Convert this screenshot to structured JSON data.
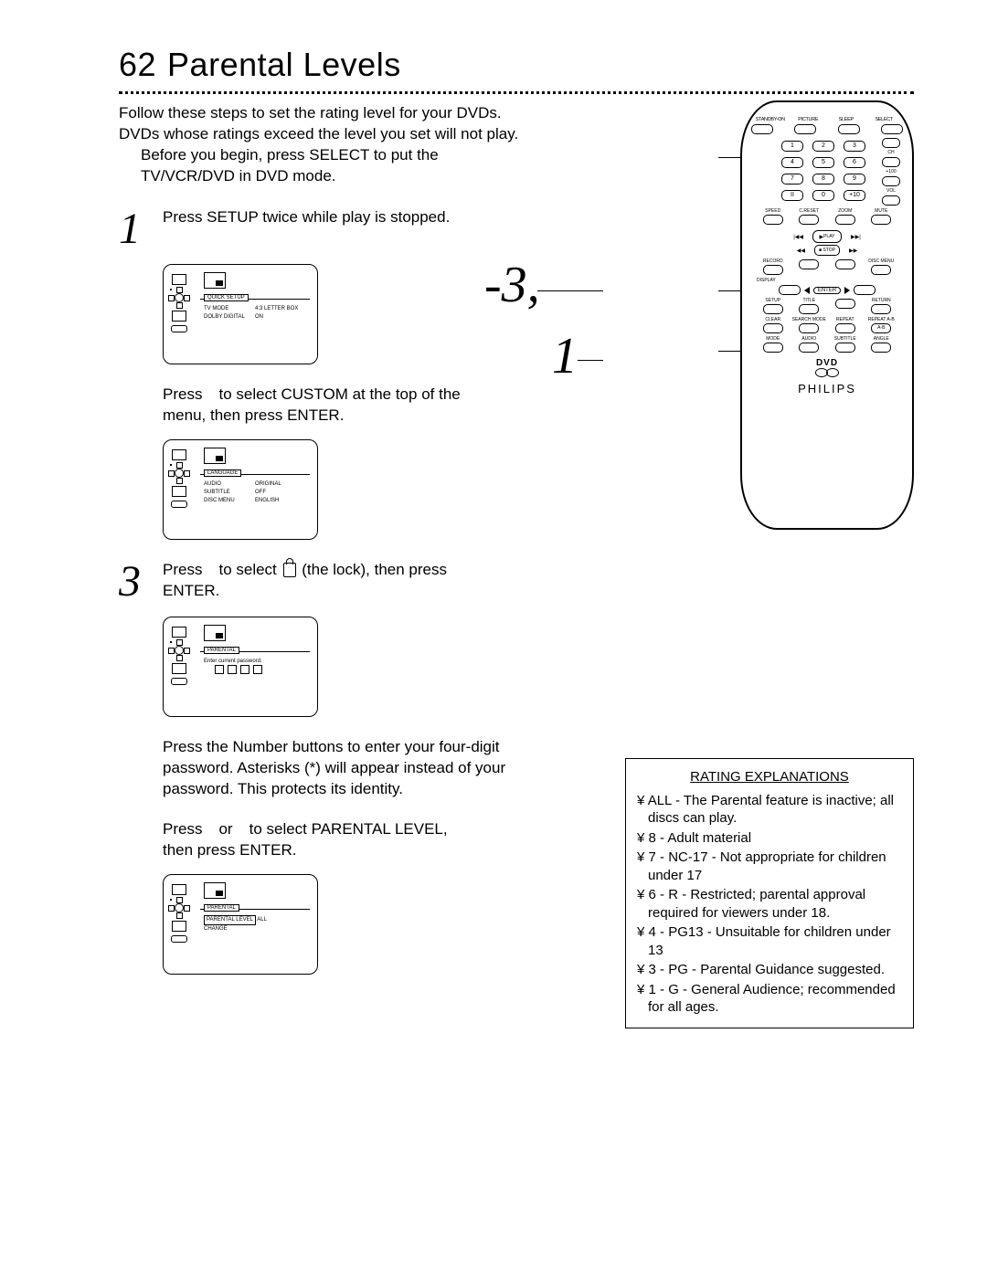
{
  "page": {
    "number": "62",
    "title": "Parental Levels"
  },
  "intro": {
    "line1": "Follow these steps to set the rating level for your DVDs.",
    "line2": "DVDs whose ratings exceed the level you set will not play.",
    "before1": "Before you begin, press SELECT to put the",
    "before2": "TV/VCR/DVD in DVD mode."
  },
  "steps": {
    "s1_num": "1",
    "s1_text": "Press SETUP twice while play is stopped.",
    "s2_text_a": "Press",
    "s2_text_b": "to select CUSTOM at the top of the",
    "s2_text_c": "menu, then press ENTER.",
    "s3_num": "3",
    "s3_text_a": "Press",
    "s3_text_b": "to select",
    "s3_text_c": "(the lock), then press",
    "s3_text_d": "ENTER.",
    "s4_text": "Press the Number buttons to enter your four-digit password. Asterisks (*) will appear instead of your password. This protects its identity.",
    "s5_text_a": "Press",
    "s5_text_b": "or",
    "s5_text_c": "to select PARENTAL LEVEL,",
    "s5_text_d": "then press ENTER."
  },
  "osd": {
    "tab_quick": "QUICK SETUP",
    "kv1a": "TV MODE",
    "kv1b": "4:3 LETTER BOX",
    "kv2a": "DOLBY DIGITAL",
    "kv2b": "ON",
    "tab_lang": "LANGUAGE",
    "kv3a": "AUDIO",
    "kv3b": "ORIGINAL",
    "kv4a": "SUBTITLE",
    "kv4b": "OFF",
    "kv5a": "DISC MENU",
    "kv5b": "ENGLISH",
    "tab_par": "PARENTAL",
    "par_prompt": "Enter current password.",
    "tab_par2": "PARENTAL",
    "plevel_label": "PARENTAL LEVEL",
    "plevel_val": "ALL",
    "change_label": "CHANGE"
  },
  "callouts": {
    "c1": "-3,",
    "c2": "1"
  },
  "remote": {
    "top_labels": [
      "STANDBY-ON",
      "PICTURE",
      "SLEEP",
      "SELECT"
    ],
    "nums": [
      [
        "1",
        "2",
        "3"
      ],
      [
        "4",
        "5",
        "6"
      ],
      [
        "7",
        "8",
        "9"
      ],
      [
        "II",
        "0",
        "+10"
      ]
    ],
    "side_right": [
      "CH",
      "+100",
      "VOL"
    ],
    "row_speed": [
      "SPEED",
      "C.RESET",
      "ZOOM",
      "MUTE"
    ],
    "play": "PLAY",
    "stop": "STOP",
    "record": "RECORD",
    "disc_menu": "DISC MENU",
    "display": "DISPLAY",
    "enter": "ENTER",
    "row_setup": [
      "SETUP",
      "TITLE",
      "",
      "RETURN"
    ],
    "row_clear": [
      "CLEAR",
      "SEARCH MODE",
      "REPEAT",
      "REPEAT A-B"
    ],
    "row_mode": [
      "MODE",
      "AUDIO",
      "SUBTITLE",
      "ANGLE"
    ],
    "dvd": "DVD",
    "brand": "PHILIPS"
  },
  "ratings": {
    "header": "RATING EXPLANATIONS",
    "items": [
      "ALL - The Parental feature is inactive; all discs can play.",
      "8 - Adult material",
      "7 - NC-17 - Not appropriate for children under 17",
      "6 - R - Restricted; parental approval required for viewers under 18.",
      "4 - PG13 - Unsuitable for children under 13",
      "3 - PG - Parental Guidance suggested.",
      "1 - G - General Audience; recommended for all ages."
    ]
  }
}
